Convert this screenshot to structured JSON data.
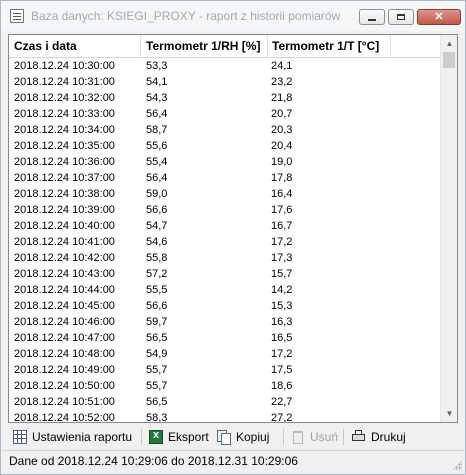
{
  "window": {
    "title": "Baza danych: KSIEGI_PROXY - raport z historii pomiarów",
    "buttons": {
      "minimize": "minimize-icon",
      "maximize": "maximize-icon",
      "close": "✕"
    }
  },
  "table": {
    "columns": [
      "Czas i data",
      "Termometr 1/RH [%]",
      "Termometr 1/T [°C]"
    ],
    "rows": [
      [
        "2018.12.24 10:30:00",
        "53,3",
        "24,1"
      ],
      [
        "2018.12.24 10:31:00",
        "54,1",
        "23,2"
      ],
      [
        "2018.12.24 10:32:00",
        "54,3",
        "21,8"
      ],
      [
        "2018.12.24 10:33:00",
        "56,4",
        "20,7"
      ],
      [
        "2018.12.24 10:34:00",
        "58,7",
        "20,3"
      ],
      [
        "2018.12.24 10:35:00",
        "55,6",
        "20,4"
      ],
      [
        "2018.12.24 10:36:00",
        "55,4",
        "19,0"
      ],
      [
        "2018.12.24 10:37:00",
        "56,4",
        "17,8"
      ],
      [
        "2018.12.24 10:38:00",
        "59,0",
        "16,4"
      ],
      [
        "2018.12.24 10:39:00",
        "56,6",
        "17,6"
      ],
      [
        "2018.12.24 10:40:00",
        "54,7",
        "16,7"
      ],
      [
        "2018.12.24 10:41:00",
        "54,6",
        "17,2"
      ],
      [
        "2018.12.24 10:42:00",
        "55,8",
        "17,3"
      ],
      [
        "2018.12.24 10:43:00",
        "57,2",
        "15,7"
      ],
      [
        "2018.12.24 10:44:00",
        "55,5",
        "14,2"
      ],
      [
        "2018.12.24 10:45:00",
        "56,6",
        "15,3"
      ],
      [
        "2018.12.24 10:46:00",
        "59,7",
        "16,3"
      ],
      [
        "2018.12.24 10:47:00",
        "56,5",
        "16,5"
      ],
      [
        "2018.12.24 10:48:00",
        "54,9",
        "17,2"
      ],
      [
        "2018.12.24 10:49:00",
        "55,7",
        "17,5"
      ],
      [
        "2018.12.24 10:50:00",
        "55,7",
        "18,6"
      ],
      [
        "2018.12.24 10:51:00",
        "56,5",
        "22,7"
      ],
      [
        "2018.12.24 10:52:00",
        "58,3",
        "27,2"
      ]
    ]
  },
  "scrollbar": {
    "up_glyph": "▲",
    "down_glyph": "▼"
  },
  "toolbar": {
    "report_settings": "Ustawienia raportu",
    "export": "Eksport",
    "copy": "Kopiuj",
    "delete": "Usuń",
    "print": "Drukuj"
  },
  "status": {
    "text": "Dane od 2018.12.24 10:29:06 do 2018.12.31 10:29:06"
  }
}
